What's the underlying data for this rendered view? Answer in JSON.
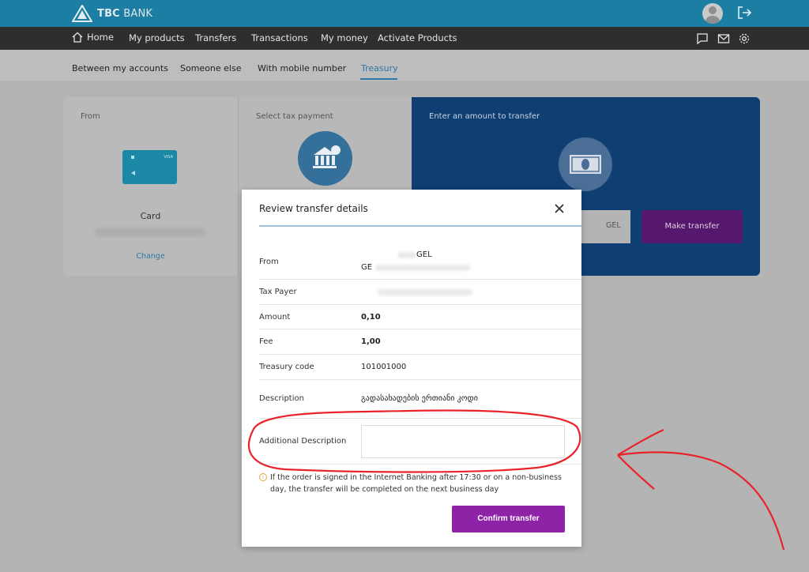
{
  "brand": {
    "name_bold": "TBC",
    "name_light": " BANK"
  },
  "topbar": {
    "avatar_icon": "user-avatar-icon",
    "logout_icon": "logout-icon"
  },
  "nav": {
    "items": [
      "Home",
      "My products",
      "Transfers",
      "Transactions",
      "My money",
      "Activate Products"
    ],
    "icons": [
      "chat-icon",
      "mail-icon",
      "gear-icon"
    ]
  },
  "subnav": {
    "items": [
      "Between my accounts",
      "Someone else",
      "With mobile number",
      "Treasury"
    ],
    "active": "Treasury"
  },
  "steps": {
    "from_label": "From",
    "card_name": "Card",
    "change_label": "Change",
    "tax_label": "Select tax payment",
    "amount_label": "Enter an amount to transfer",
    "currency": "GEL",
    "make_transfer": "Make transfer"
  },
  "modal": {
    "title": "Review transfer details",
    "rows": [
      {
        "label": "From",
        "value_line1": "GEL",
        "value_line2": "GE"
      },
      {
        "label": "Tax Payer",
        "value": ""
      },
      {
        "label": "Amount",
        "value": "0,10"
      },
      {
        "label": "Fee",
        "value": "1,00"
      },
      {
        "label": "Treasury code",
        "value": "101001000"
      },
      {
        "label": "Description",
        "value": "გადასახადების ერთიანი კოდი"
      },
      {
        "label": "Additional Description",
        "value": ""
      }
    ],
    "notice": "If the order is signed in the Internet Banking after 17:30 or on a non-business day, the transfer will be completed on the next business day",
    "confirm": "Confirm transfer"
  },
  "colors": {
    "brand": "#1c7ea3",
    "nav": "#2e2e2e",
    "accent": "#8e23a8",
    "link": "#2d78a5",
    "annotation": "#e8232b"
  }
}
